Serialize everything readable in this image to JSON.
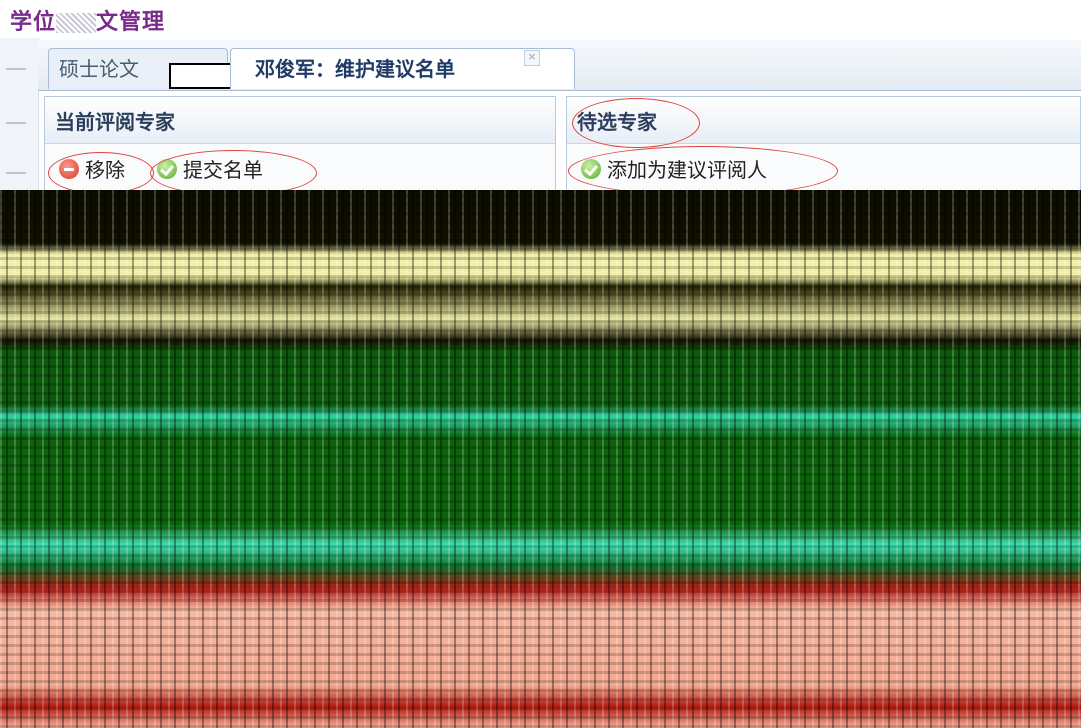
{
  "app": {
    "title_part1": "学位",
    "title_part2": "文管理"
  },
  "tabs": {
    "thesis_label": "硕士论文",
    "active_label": "邓俊军：维护建议名单",
    "close_symbol": "×"
  },
  "left_panel": {
    "title": "当前评阅专家",
    "remove_label": "移除",
    "submit_label": "提交名单"
  },
  "right_panel": {
    "title": "待选专家",
    "add_label": "添加为建议评阅人"
  },
  "colors": {
    "title_purple": "#7a2a8a",
    "annotation_red": "#e0453a",
    "panel_border": "#b9c9dc"
  }
}
